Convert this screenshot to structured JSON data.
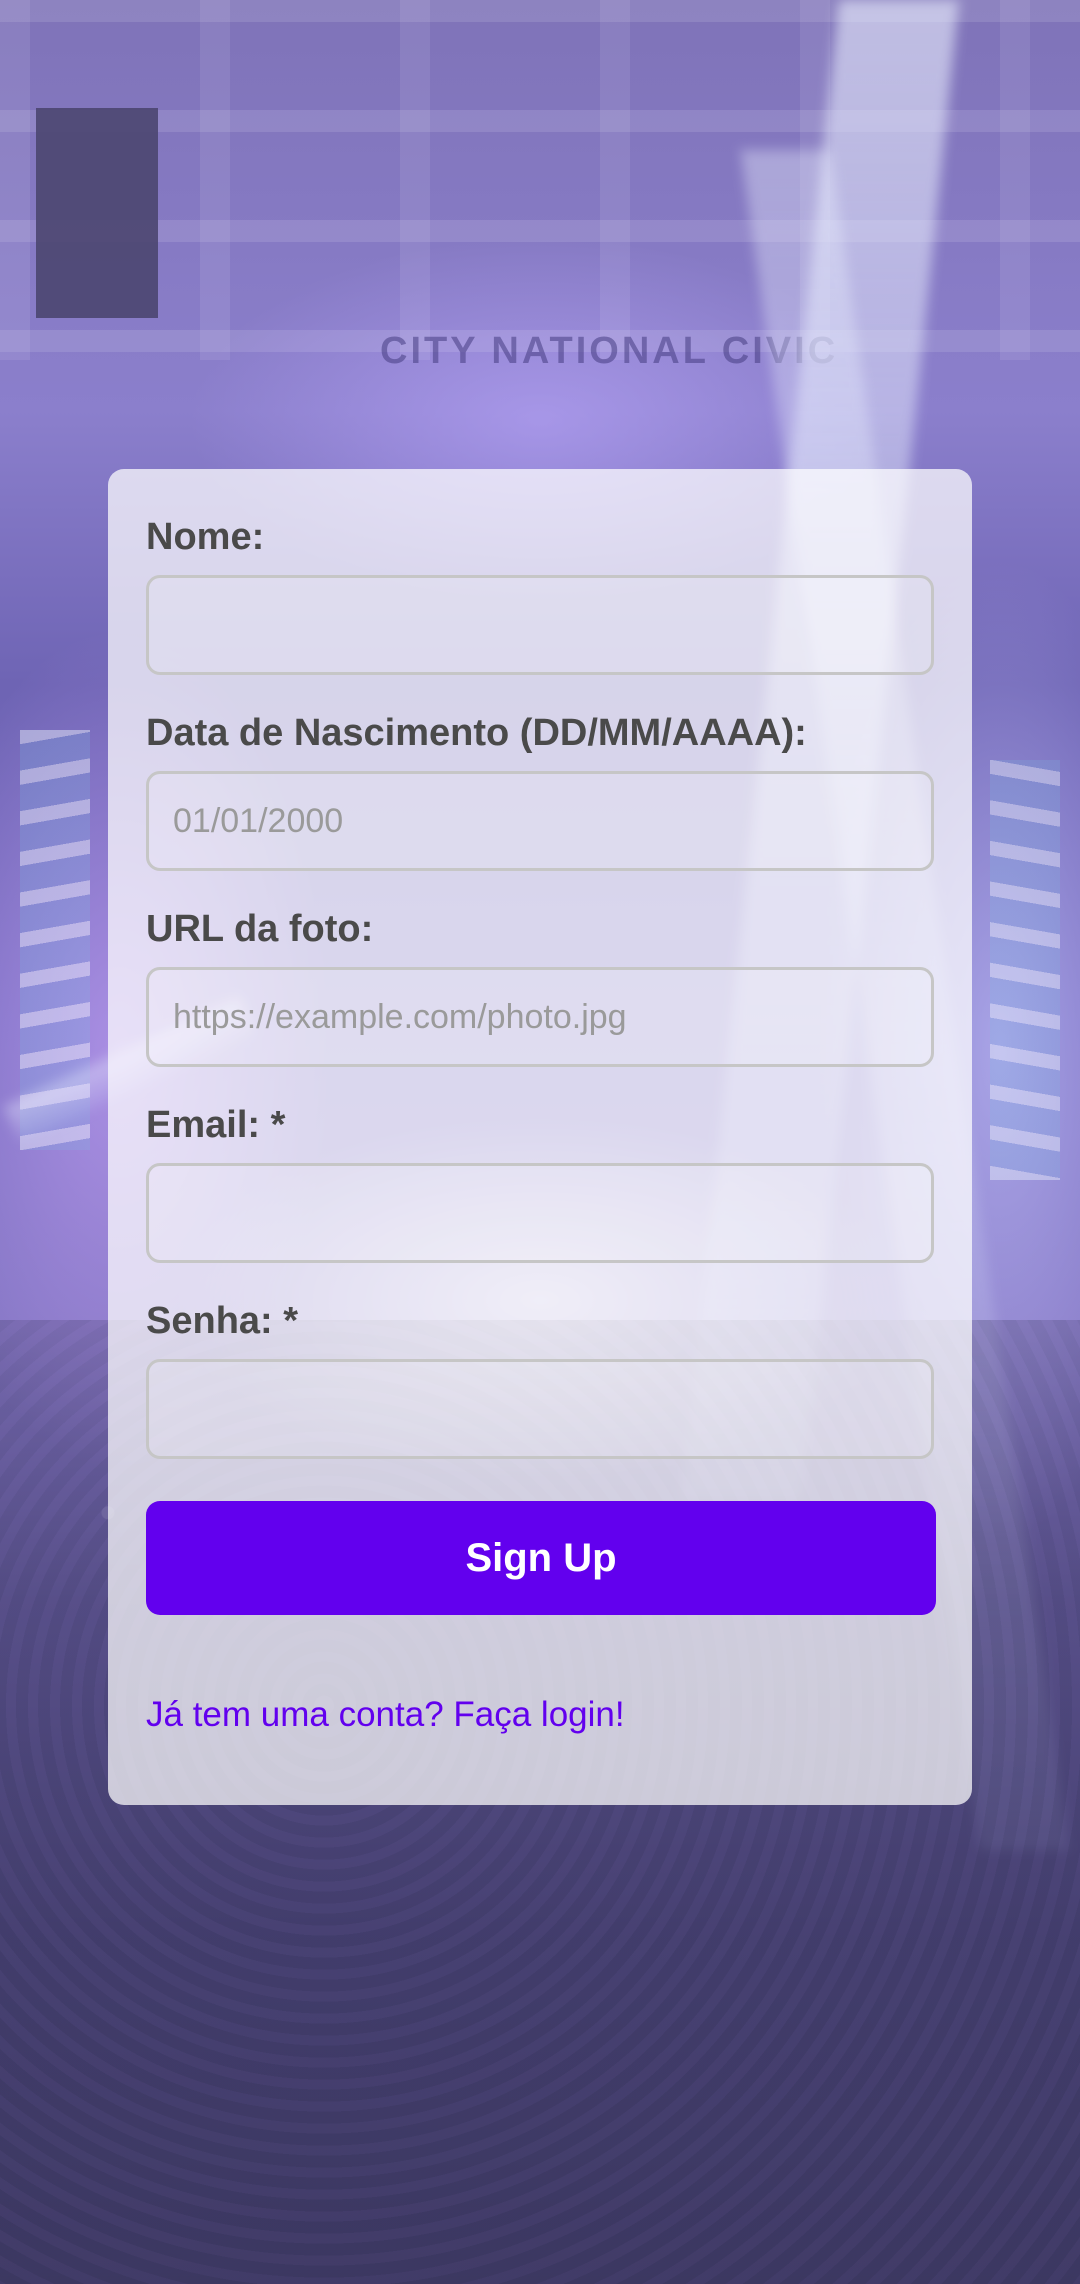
{
  "background": {
    "venue_sign": "CITY NATIONAL CIVIC"
  },
  "form": {
    "fields": [
      {
        "id": "name",
        "label": "Nome:",
        "placeholder": "",
        "value": ""
      },
      {
        "id": "birthdate",
        "label": "Data de Nascimento (DD/MM/AAAA):",
        "placeholder": "01/01/2000",
        "value": ""
      },
      {
        "id": "photo_url",
        "label": "URL da foto:",
        "placeholder": "https://example.com/photo.jpg",
        "value": ""
      },
      {
        "id": "email",
        "label": "Email: *",
        "placeholder": "",
        "value": ""
      },
      {
        "id": "password",
        "label": "Senha: *",
        "placeholder": "",
        "value": ""
      }
    ],
    "submit_label": "Sign Up",
    "login_link": "Já tem uma conta? Faça login!"
  },
  "colors": {
    "accent": "#6200ee",
    "label_text": "#4a4a4a",
    "placeholder_text": "#9a9a9a",
    "input_border": "#c6c6c6",
    "card_background": "rgba(255,255,255,0.72)"
  }
}
